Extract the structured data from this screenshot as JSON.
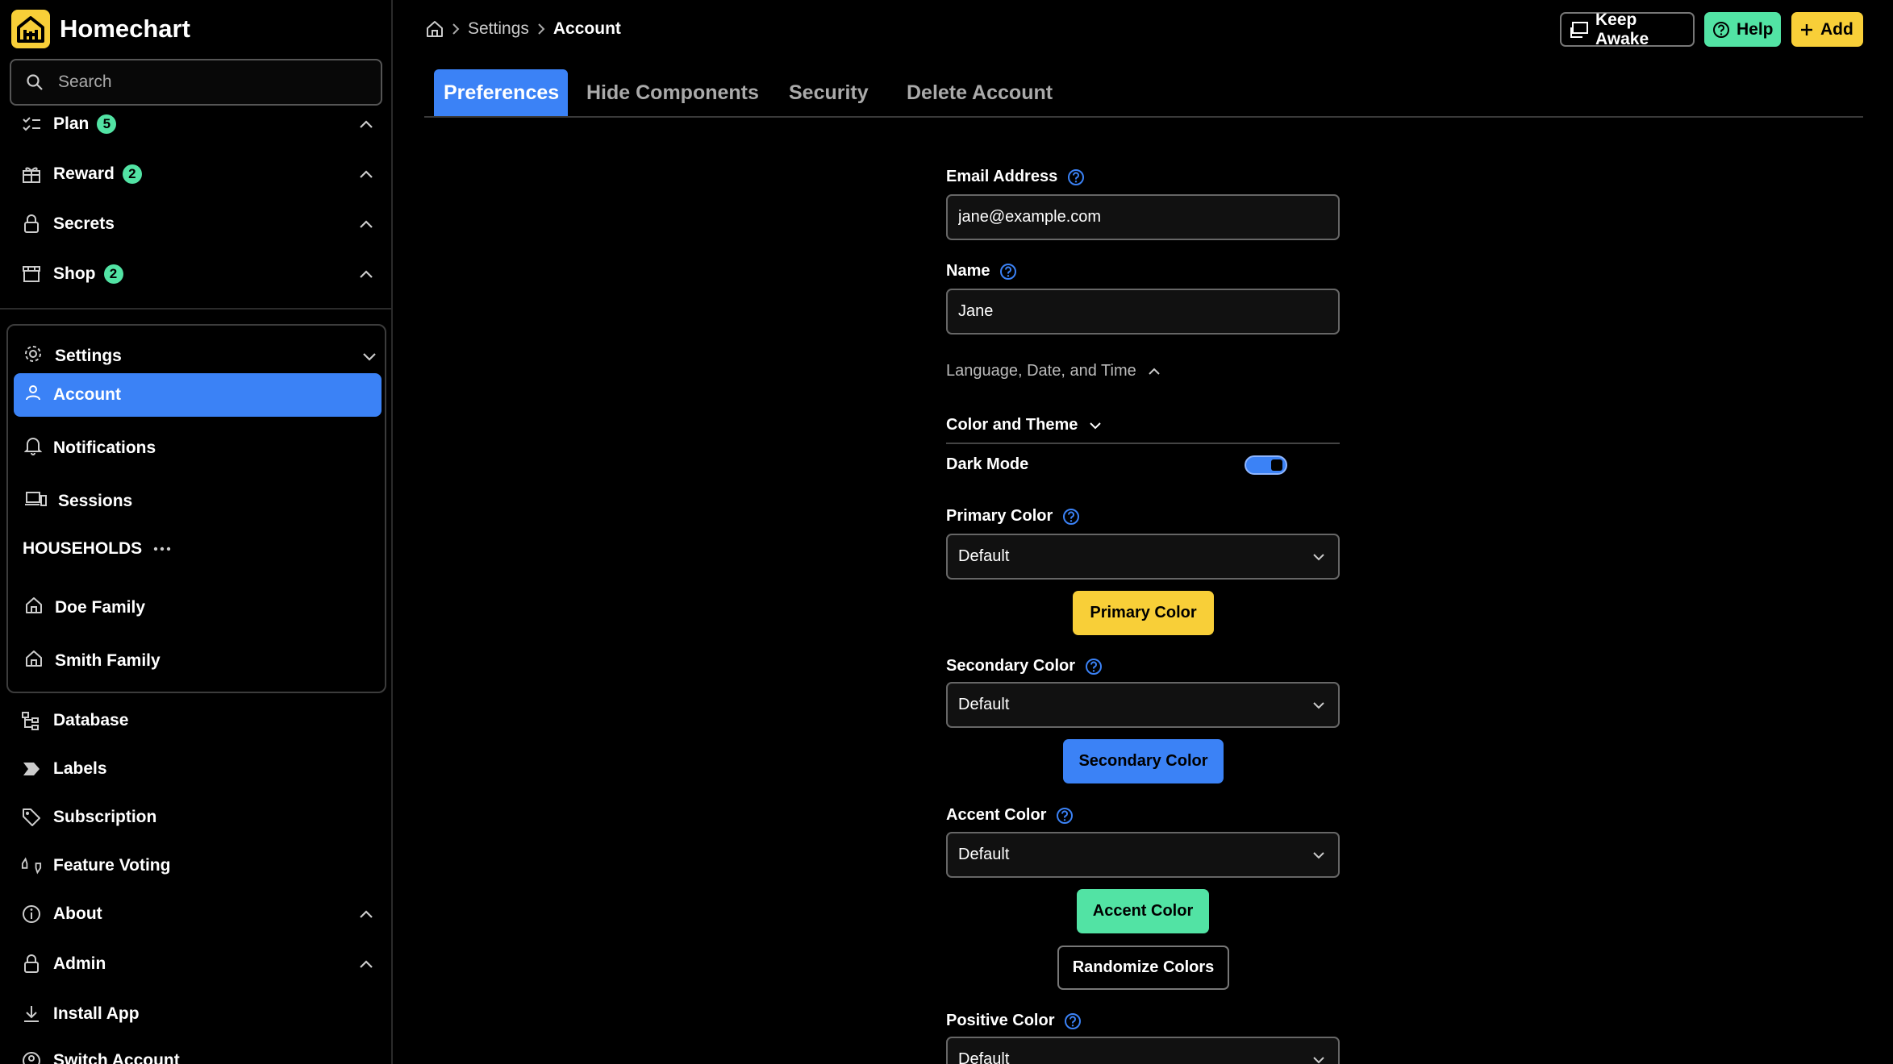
{
  "app": {
    "name": "Homechart"
  },
  "search": {
    "placeholder": "Search"
  },
  "sidebar": {
    "top_items": [
      {
        "label": "Plan",
        "badge": "5"
      },
      {
        "label": "Reward",
        "badge": "2"
      },
      {
        "label": "Secrets"
      },
      {
        "label": "Shop",
        "badge": "2"
      }
    ],
    "settings": {
      "label": "Settings",
      "items": [
        {
          "label": "Account"
        },
        {
          "label": "Notifications"
        },
        {
          "label": "Sessions"
        }
      ],
      "households_label": "HOUSEHOLDS",
      "households": [
        {
          "label": "Doe Family"
        },
        {
          "label": "Smith Family"
        }
      ]
    },
    "bottom_items": [
      {
        "label": "Database"
      },
      {
        "label": "Labels"
      },
      {
        "label": "Subscription"
      },
      {
        "label": "Feature Voting"
      },
      {
        "label": "About"
      },
      {
        "label": "Admin"
      },
      {
        "label": "Install App"
      },
      {
        "label": "Switch Account"
      }
    ]
  },
  "breadcrumb": {
    "parent": "Settings",
    "current": "Account"
  },
  "header": {
    "keep_awake": "Keep Awake",
    "help": "Help",
    "add": "Add"
  },
  "tabs": [
    "Preferences",
    "Hide Components",
    "Security",
    "Delete Account"
  ],
  "form": {
    "email": {
      "label": "Email Address",
      "value": "jane@example.com"
    },
    "name": {
      "label": "Name",
      "value": "Jane"
    },
    "language_section": "Language, Date, and Time",
    "color_section": "Color and Theme",
    "dark_mode": {
      "label": "Dark Mode",
      "on": true
    },
    "primary_color": {
      "label": "Primary Color",
      "value": "Default",
      "button": "Primary Color"
    },
    "secondary_color": {
      "label": "Secondary Color",
      "value": "Default",
      "button": "Secondary Color"
    },
    "accent_color": {
      "label": "Accent Color",
      "value": "Default",
      "button": "Accent Color"
    },
    "randomize": "Randomize Colors",
    "positive_color": {
      "label": "Positive Color",
      "value": "Default"
    }
  },
  "colors": {
    "primary": "#f8cf38",
    "secondary": "#3b82f6",
    "accent": "#52e3a4",
    "background": "#000000"
  },
  "icons": {
    "logo": "home-logo-icon",
    "search": "search-icon",
    "plan": "checklist-icon",
    "reward": "gift-icon",
    "secrets": "lock-icon",
    "shop": "store-icon",
    "settings": "gear-icon",
    "account": "user-icon",
    "notifications": "bell-icon",
    "sessions": "devices-icon",
    "household": "house-icon",
    "database": "database-icon",
    "labels": "label-icon",
    "subscription": "tag-icon",
    "feature_voting": "vote-icon",
    "about": "info-icon",
    "admin": "lock-icon",
    "install": "download-icon",
    "home": "home-icon",
    "help": "question-circle-icon"
  }
}
